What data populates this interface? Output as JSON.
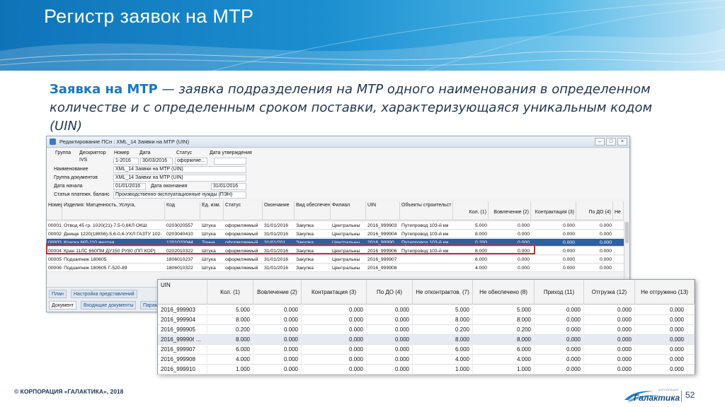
{
  "slide": {
    "title": "Регистр заявок на МТР",
    "definition_term": "Заявка на МТР",
    "definition_text": " — заявка подразделения на МТР одного наименования в определенном количестве и с определенным сроком поставки, характеризующаяся уникальным кодом (UIN)",
    "copyright": "© КОРПОРАЦИЯ «ГАЛАКТИКА», 2018",
    "logo_text": "Галактика",
    "logo_subtext": "КОРПОРАЦИЯ",
    "page_number": "52",
    "colors": {
      "banner": "#1c8fd0",
      "term": "#1877c0",
      "highlight": "#d6262b"
    }
  },
  "window": {
    "title": "Редактирование ПСн : XML_14 Заявки на МТР (UIN)",
    "controls": [
      "–",
      "□",
      "×"
    ],
    "form": {
      "labels": {
        "group": "Группа",
        "descriptor": "Дескриптор",
        "number": "Номер",
        "date": "Дата",
        "status": "Статус",
        "approval_date": "Дата утверждения",
        "name": "Наименование",
        "doc_group": "Группа документов",
        "start_date": "Дата начала",
        "end_date": "Дата окончания",
        "payment_article": "Статья платежн. баланс"
      },
      "values": {
        "descriptor": "IVS",
        "number": "1-2016",
        "date": "30/03/2016",
        "status": "оформляе...",
        "name": "XML_14 Заявки на МТР (UIN)",
        "doc_group": "XML_14 Заявки на МТР (UIN)",
        "start_date": "01/01/2016",
        "end_date": "31/01/2016",
        "payment_article": "Производственно-эксплуатационные нужды (ПЭН)"
      }
    },
    "grid": {
      "columns": [
        "Номер",
        "Изделия: Матценность, Услуга,",
        "Код",
        "Ед. изм.",
        "Статус",
        "Окончание",
        "Вид обеспечен",
        "Филиал",
        "UIN",
        "Объекты строительст",
        "Кол. (1)",
        "Вовлечение (2)",
        "Контрактация (3)",
        "По ДО (4)",
        "Не"
      ],
      "rows": [
        [
          "00001",
          "Отвод 45 гр. 1020(21)-7,5-0,6КЛ ОКШ",
          "0203020557",
          "Штука",
          "оформляемый",
          "31/01/2016",
          "Закупка",
          "Центральны",
          "2016_999903",
          "Путепровод 103-й км",
          "5.000",
          "0.000",
          "0.000",
          "0.000"
        ],
        [
          "00002",
          "Днище 1220(18К56)-5,6-0,6-УХЛ ГАЗТУ 102-",
          "0203040410",
          "Штука",
          "оформляемый",
          "31/01/2016",
          "Закупка",
          "Центральны",
          "2016_999904",
          "Путепровод 103-й км",
          "8.000",
          "0.000",
          "0.000",
          "0.000"
        ],
        [
          "00003",
          "Краска МЛ-110 желтая",
          "1201020044",
          "Тонна",
          "оформляемый",
          "31/01/201",
          "Закупка",
          "Центральны",
          "2016_99990",
          "Путепровод 103-й км",
          "0.200",
          "0.000",
          "0.000",
          "0.000"
        ],
        [
          "00004",
          "Кран 11ЛС 660ПМ ДУ150 РУ80 (ПП КОР)",
          "0202010322",
          "Штука",
          "оформляемый",
          "31/01/2016",
          "Закупка",
          "Центральны",
          "2016_999906",
          "Путепровод 103-й км",
          "8.000",
          "0.000",
          "0.000",
          "0.000"
        ],
        [
          "00005",
          "Подшипник 180605",
          "1806010237",
          "Штука",
          "оформляемый",
          "31/01/2016",
          "Закупка",
          "Центральны",
          "2016_999907",
          "",
          "6.000",
          "0.000",
          "0.000",
          "0.000"
        ],
        [
          "00006",
          "Подшипник 180605 Г-520-89",
          "1806010322",
          "Штука",
          "оформляемый",
          "31/01/2016",
          "Закупка",
          "Центральны",
          "2016_999908",
          "",
          "4.000",
          "0.000",
          "0.000",
          "0.000"
        ]
      ]
    },
    "tabs": [
      "План",
      "Настройка представлений",
      "Документ",
      "Входящие документы",
      "Парам"
    ]
  },
  "zoom_table": {
    "columns": [
      "UIN",
      "Кол. (1)",
      "Вовлечение (2)",
      "Контрактация (3)",
      "По ДО (4)",
      "Не отконтрактов. (7)",
      "Не обеспечено (8)",
      "Приход (11)",
      "Отгрузка (12)",
      "Не отгружено (13)"
    ],
    "rows": [
      [
        "2016_999903",
        "5.000",
        "0.000",
        "0.000",
        "0.000",
        "5.000",
        "5.000",
        "0.000",
        "0.000",
        "0.000"
      ],
      [
        "2016_999904",
        "8.000",
        "0.000",
        "0.000",
        "0.000",
        "8.000",
        "8.000",
        "0.000",
        "0.000",
        "0.000"
      ],
      [
        "2016_999905",
        "0.200",
        "0.000",
        "0.000",
        "0.000",
        "0.200",
        "0.200",
        "0.000",
        "0.000",
        "0.000"
      ],
      [
        "2016_999906",
        "8.000",
        "0.000",
        "0.000",
        "0.000",
        "8.000",
        "8.000",
        "0.000",
        "0.000",
        "0.000"
      ],
      [
        "2016_999907",
        "6.000",
        "0.000",
        "0.000",
        "0.000",
        "6.000",
        "6.000",
        "0.000",
        "0.000",
        "0.000"
      ],
      [
        "2016_999908",
        "4.000",
        "0.000",
        "0.000",
        "0.000",
        "4.000",
        "4.000",
        "0.000",
        "0.000",
        "0.000"
      ],
      [
        "2016_999910",
        "1.000",
        "0.000",
        "0.000",
        "0.000",
        "1.000",
        "1.000",
        "0.000",
        "0.000",
        "0.000"
      ]
    ],
    "ellipsis": "..."
  }
}
